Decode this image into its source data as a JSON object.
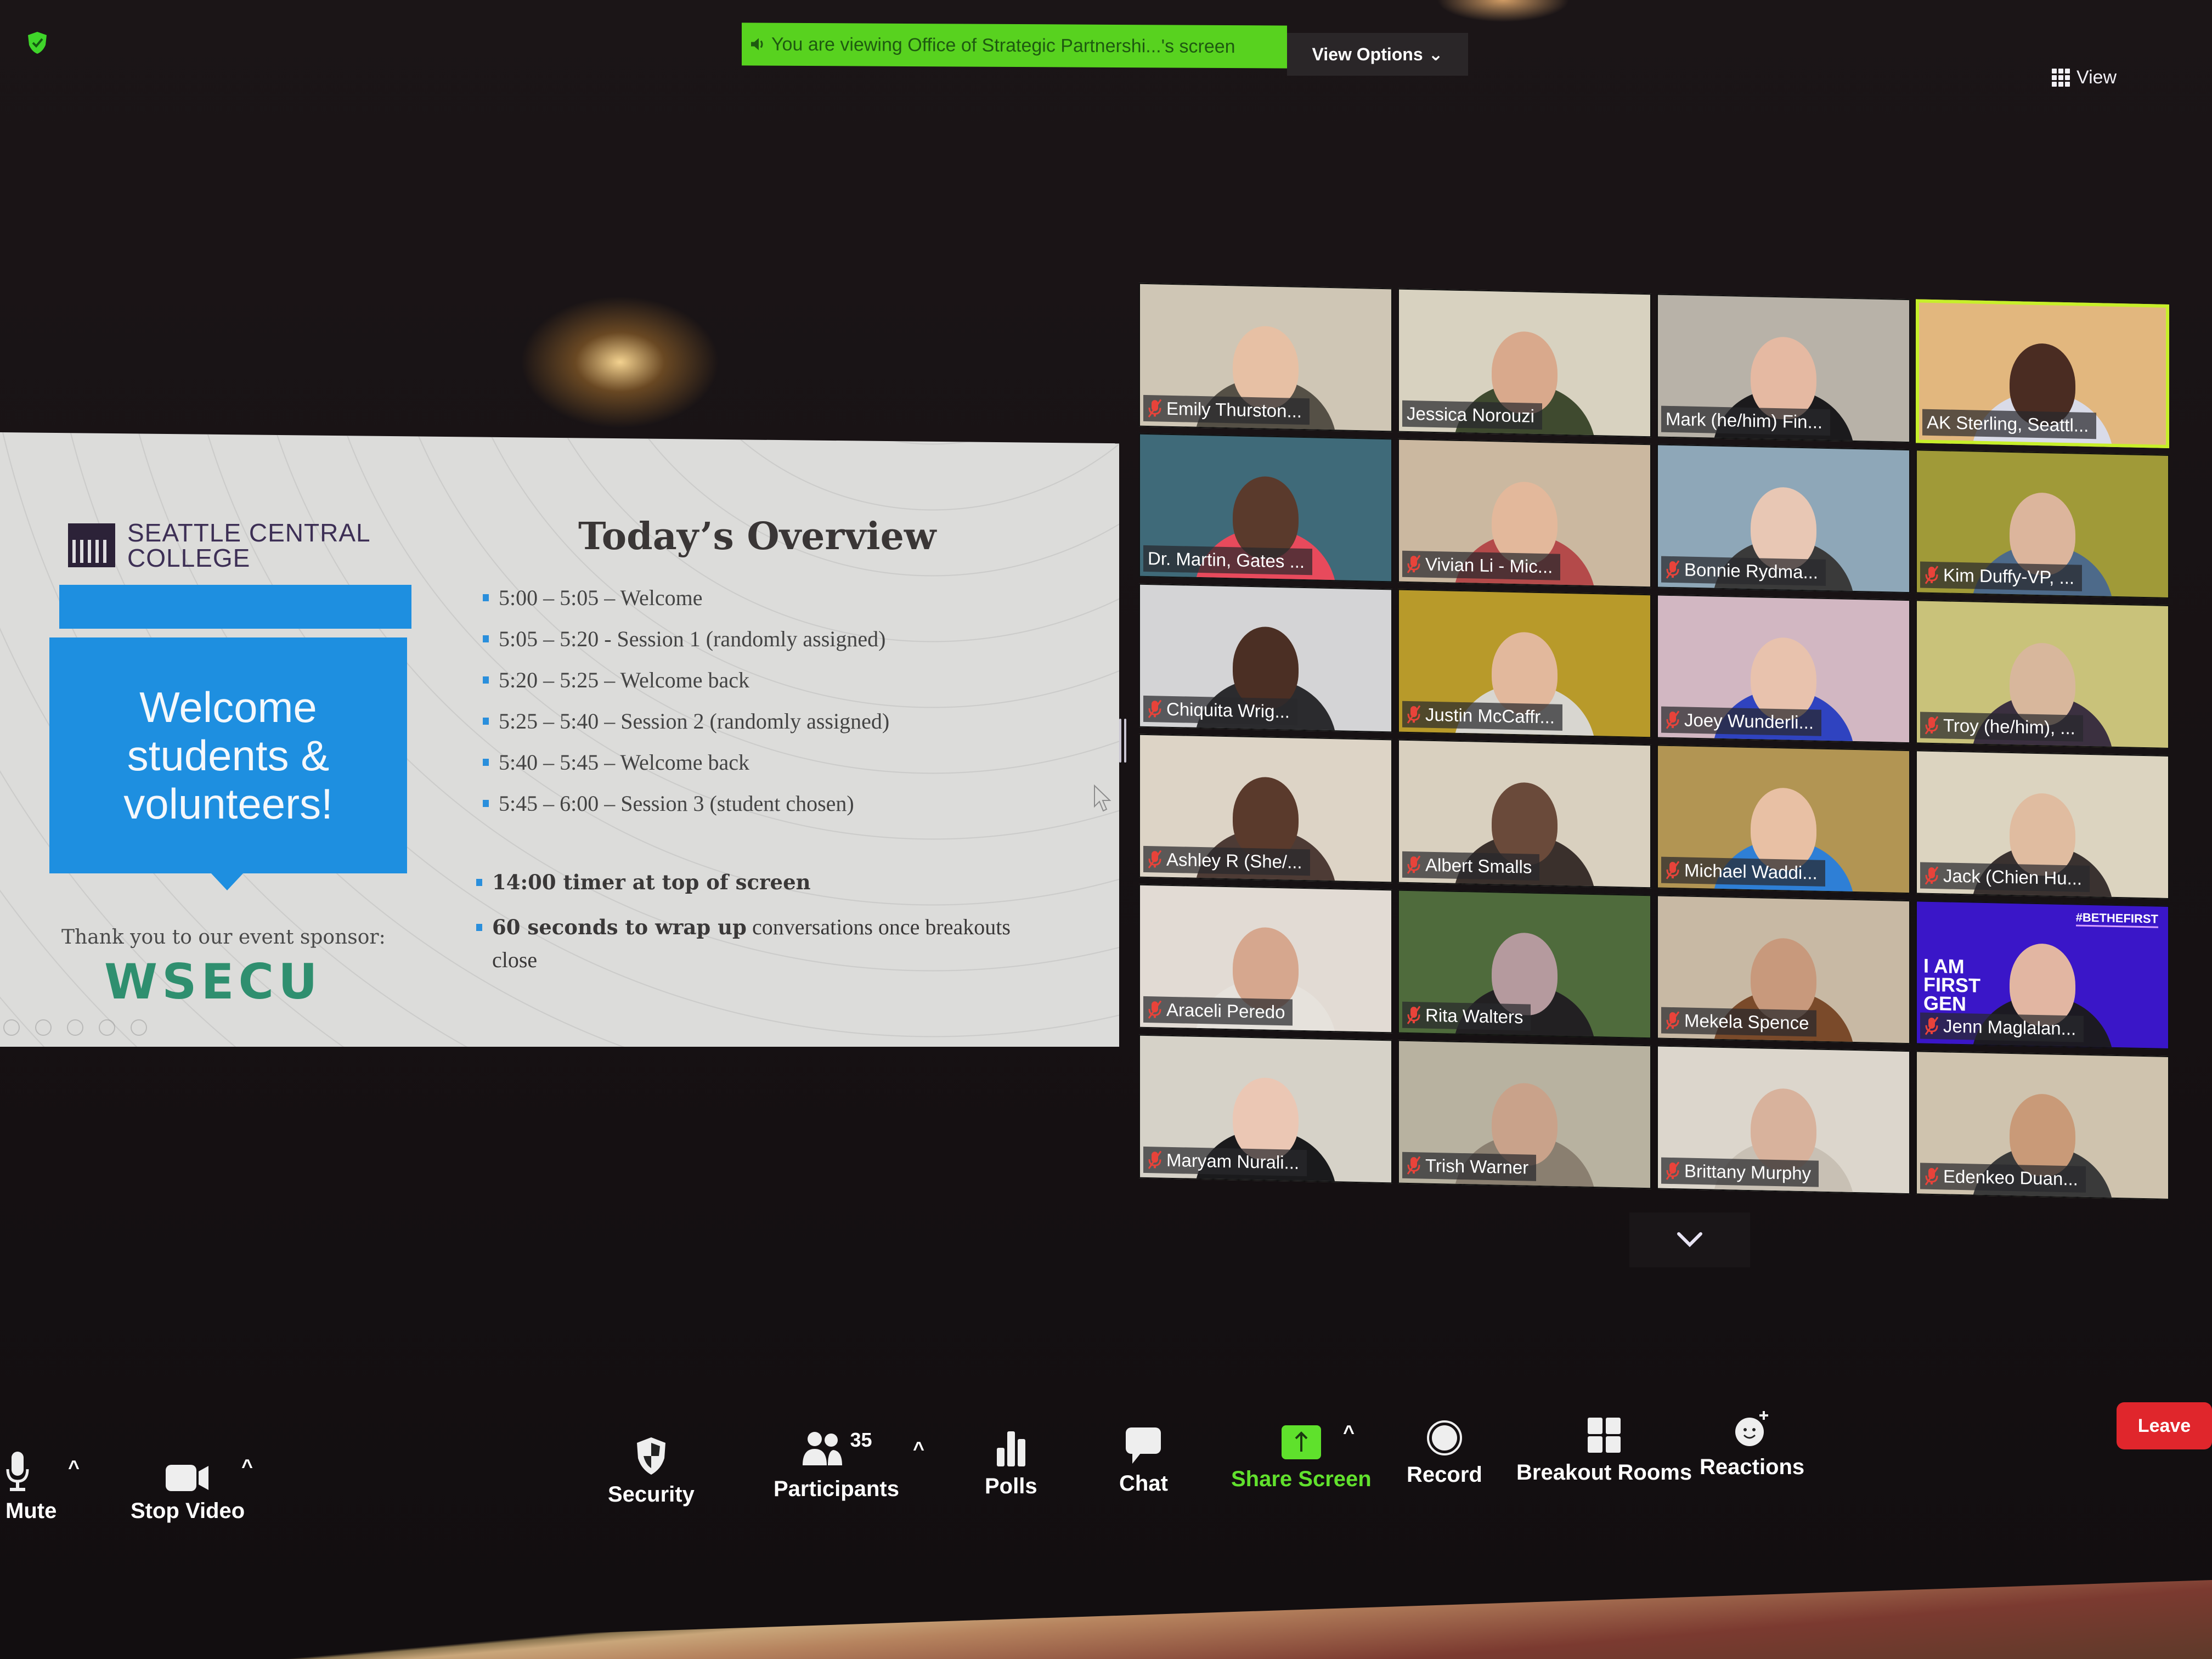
{
  "top_bar": {
    "security_badge": "encryption-shield-check",
    "share_banner": "You are viewing Office of Strategic Partnershi...'s screen",
    "view_options_label": "View Options",
    "view_label": "View"
  },
  "colors": {
    "banner_green": "#58d21f",
    "active_speaker_border": "#c7ef2a",
    "leave_red": "#e0262c",
    "share_screen_green": "#61e12d",
    "muted_red": "#e8433a",
    "slide_blue": "#1e8fe0",
    "sponsor_green": "#2f8f6f"
  },
  "slide": {
    "college_name_line1": "SEATTLE CENTRAL",
    "college_name_line2": "COLLEGE",
    "welcome_line1": "Welcome",
    "welcome_line2": "students &",
    "welcome_line3": "volunteers!",
    "sponsor_text": "Thank you to our event sponsor:",
    "sponsor_name": "WSECU",
    "title": "Today’s Overview",
    "agenda": [
      "5:00 – 5:05 – Welcome",
      "5:05 – 5:20 -  Session 1 (randomly assigned)",
      "5:20 – 5:25 – Welcome back",
      "5:25 – 5:40 – Session 2 (randomly assigned)",
      "5:40 – 5:45 – Welcome back",
      "5:45 – 6:00 – Session 3 (student chosen)"
    ],
    "notes": [
      {
        "bold": "14:00 timer at top of screen",
        "rest": ""
      },
      {
        "bold": "60 seconds to wrap up",
        "rest": " conversations once breakouts close"
      }
    ]
  },
  "participants": [
    {
      "name": "Emily Thurston...",
      "muted": true,
      "active": false,
      "bg": "#cfc6b5",
      "skin": "#e7c0a4",
      "shirt": "#555046"
    },
    {
      "name": "Jessica Norouzi",
      "muted": false,
      "active": false,
      "bg": "#d8d2c0",
      "skin": "#d9a98c",
      "shirt": "#3f4a2f"
    },
    {
      "name": "Mark (he/him) Fin...",
      "muted": false,
      "active": false,
      "bg": "#b8b2a8",
      "skin": "#e5b9a2",
      "shirt": "#1b1a1c"
    },
    {
      "name": "AK Sterling, Seattl...",
      "muted": false,
      "active": true,
      "bg": "#e2b77e",
      "skin": "#4a2c22",
      "shirt": "#d9dbe8"
    },
    {
      "name": "Dr. Martin, Gates ...",
      "muted": false,
      "active": false,
      "bg": "#3f6a79",
      "skin": "#5a3a2c",
      "shirt": "#e84a5c"
    },
    {
      "name": "Vivian Li - Mic...",
      "muted": true,
      "active": false,
      "bg": "#cbb8a0",
      "skin": "#e3b89b",
      "shirt": "#b44a4a"
    },
    {
      "name": "Bonnie Rydma...",
      "muted": true,
      "active": false,
      "bg": "#8ea7b8",
      "skin": "#e8c7b4",
      "shirt": "#3a3a3a"
    },
    {
      "name": "Kim Duffy-VP, ...",
      "muted": true,
      "active": false,
      "bg": "#a09a38",
      "skin": "#dcb59c",
      "shirt": "#4d6a8a"
    },
    {
      "name": "Chiquita Wrig...",
      "muted": true,
      "active": false,
      "bg": "#d4d4d6",
      "skin": "#4b2f24",
      "shirt": "#2b2b2e"
    },
    {
      "name": "Justin McCaffr...",
      "muted": true,
      "active": false,
      "bg": "#b89a2a",
      "skin": "#e2b89c",
      "shirt": "#d8d6d0"
    },
    {
      "name": "Joey Wunderli...",
      "muted": true,
      "active": false,
      "bg": "#d2b7c2",
      "skin": "#e8c2ad",
      "shirt": "#2f43c0"
    },
    {
      "name": "Troy (he/him), ...",
      "muted": true,
      "active": false,
      "bg": "#c9c27a",
      "skin": "#d8b79c",
      "shirt": "#3b3040"
    },
    {
      "name": "Ashley R (She/...",
      "muted": true,
      "active": false,
      "bg": "#ddd4c6",
      "skin": "#5a3a2c",
      "shirt": "#4d3b35"
    },
    {
      "name": "Albert Smalls",
      "muted": true,
      "active": false,
      "bg": "#d9d0bf",
      "skin": "#6a4a3a",
      "shirt": "#3a302c"
    },
    {
      "name": "Michael Waddi...",
      "muted": true,
      "active": false,
      "bg": "#b29553",
      "skin": "#e8c0a4",
      "shirt": "#2e7fd6"
    },
    {
      "name": "Jack (Chien Hu...",
      "muted": true,
      "active": false,
      "bg": "#dcd4c0",
      "skin": "#e0bca0",
      "shirt": "#3a3230"
    },
    {
      "name": "Araceli Peredo",
      "muted": true,
      "active": false,
      "bg": "#e2dbd4",
      "skin": "#d6a78e",
      "shirt": "#e6e2dc"
    },
    {
      "name": "Rita Walters",
      "muted": true,
      "active": false,
      "bg": "#4f6b3c",
      "skin": "#b59a9e",
      "shirt": "#222022"
    },
    {
      "name": "Mekela Spence",
      "muted": true,
      "active": false,
      "bg": "#c8b9a4",
      "skin": "#c8997c",
      "shirt": "#7a4a2a"
    },
    {
      "name": "Jenn Maglalan...",
      "muted": true,
      "active": false,
      "bg": "#3a16c8",
      "skin": "#e2b6a2",
      "shirt": "#1c1a22",
      "overlay_tag": "#BETHEFIRST",
      "overlay_text": "I AM FIRST GEN"
    },
    {
      "name": "Maryam Nurali...",
      "muted": true,
      "active": false,
      "bg": "#d6d2c8",
      "skin": "#ebc7b4",
      "shirt": "#1a1a1c"
    },
    {
      "name": "Trish Warner",
      "muted": true,
      "active": false,
      "bg": "#b8b2a0",
      "skin": "#c9a28a",
      "shirt": "#8a7f70"
    },
    {
      "name": "Brittany Murphy",
      "muted": true,
      "active": false,
      "bg": "#dcd6cc",
      "skin": "#d8b29c",
      "shirt": "#c8c0b4"
    },
    {
      "name": "Edenkeo Duan...",
      "muted": true,
      "active": false,
      "bg": "#cfc3ae",
      "skin": "#c99a78",
      "shirt": "#3a3a3a"
    }
  ],
  "toolbar": {
    "mute": "Mute",
    "stop_video": "Stop Video",
    "security": "Security",
    "participants": "Participants",
    "participant_count": "35",
    "polls": "Polls",
    "chat": "Chat",
    "share_screen": "Share Screen",
    "record": "Record",
    "breakout_rooms": "Breakout Rooms",
    "reactions": "Reactions",
    "leave": "Leave"
  }
}
